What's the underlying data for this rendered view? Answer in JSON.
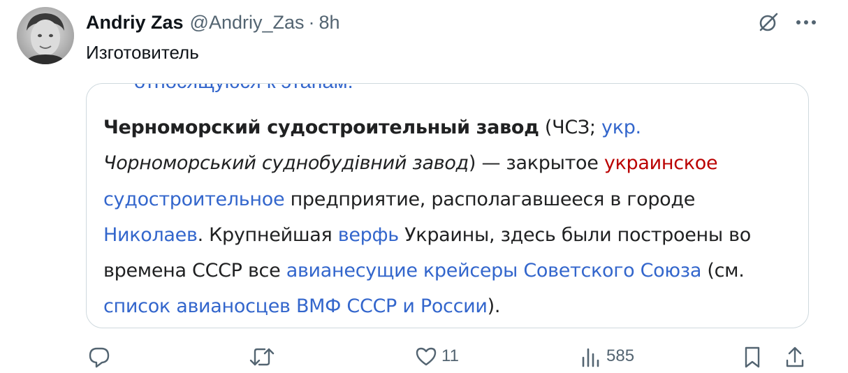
{
  "author": {
    "display_name": "Andriy Zas",
    "handle": "@Andriy_Zas",
    "separator": "·",
    "time": "8h"
  },
  "tweet": {
    "text": "Изготовитель"
  },
  "media": {
    "cut_line": "относящуюся к этапам.",
    "wiki": {
      "s1_bold": "Черноморский судостроительный завод",
      "s2": " (ЧСЗ; ",
      "s3_link": "укр.",
      "s4_space": " ",
      "s5_italic": "Чорноморський суднобудівний завод",
      "s6": ") — закрытое ",
      "s7_redlink": "украинское",
      "s8_space": " ",
      "s9_link": "судостроительное",
      "s10": " предприятие, располагавшееся в городе ",
      "s11_link": "Николаев",
      "s12": ". Крупнейшая ",
      "s13_link": "верфь",
      "s14": " Украины, здесь были построены во времена СССР все ",
      "s15_link": "авианесущие крейсеры Советского Союза",
      "s16": " (см. ",
      "s17_link": "список авианосцев ВМФ СССР и России",
      "s18": ")."
    }
  },
  "actions": {
    "reply_count": "",
    "retweet_count": "",
    "like_count": "11",
    "views_count": "585"
  },
  "icons": {
    "grok": "grok-icon",
    "more": "more-icon",
    "reply": "reply-icon",
    "retweet": "retweet-icon",
    "like": "heart-icon",
    "views": "views-icon",
    "bookmark": "bookmark-icon",
    "share": "share-icon"
  },
  "colors": {
    "text": "#0f1419",
    "secondary": "#536471",
    "border": "#cfd9de",
    "wiki_link": "#3366cc",
    "wiki_redlink": "#ba0000"
  }
}
